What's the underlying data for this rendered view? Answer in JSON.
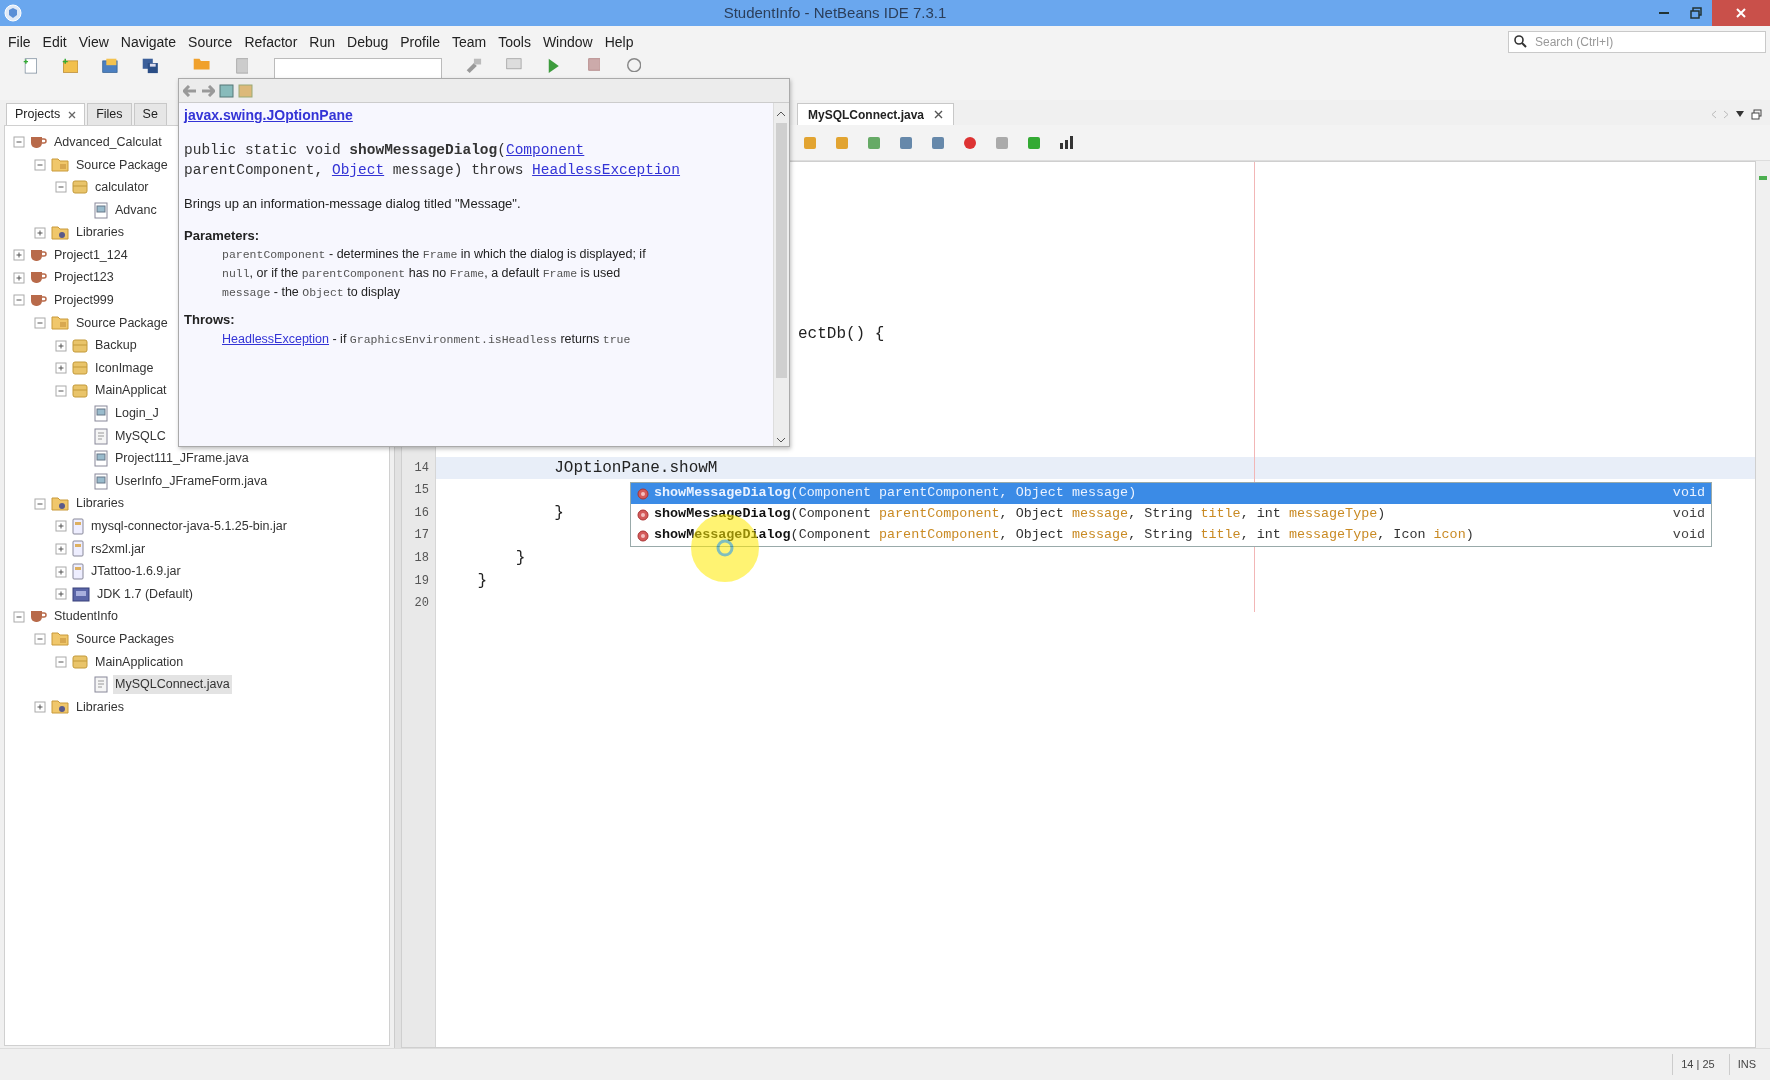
{
  "window": {
    "title": "StudentInfo - NetBeans IDE 7.3.1"
  },
  "menu": [
    "File",
    "Edit",
    "View",
    "Navigate",
    "Source",
    "Refactor",
    "Run",
    "Debug",
    "Profile",
    "Team",
    "Tools",
    "Window",
    "Help"
  ],
  "search": {
    "placeholder": "Search (Ctrl+I)"
  },
  "left_tabs": [
    {
      "label": "Projects",
      "selected": true
    },
    {
      "label": "Files",
      "selected": false
    },
    {
      "label": "Se",
      "selected": false
    }
  ],
  "project_tree": [
    {
      "label": "Advanced_Calculat",
      "kind": "project",
      "expanded": true,
      "selected": false,
      "children": [
        {
          "label": "Source Package",
          "kind": "sources",
          "expanded": true,
          "selected": false,
          "children": [
            {
              "label": "calculator",
              "kind": "package",
              "expanded": true,
              "selected": false,
              "children": [
                {
                  "label": "Advanc",
                  "kind": "form",
                  "selected": false
                }
              ]
            }
          ]
        },
        {
          "label": "Libraries",
          "kind": "libraries",
          "expanded": false,
          "selected": false
        }
      ]
    },
    {
      "label": "Project1_124",
      "kind": "project",
      "expanded": false,
      "selected": false
    },
    {
      "label": "Project123",
      "kind": "project",
      "expanded": false,
      "selected": false
    },
    {
      "label": "Project999",
      "kind": "project",
      "expanded": true,
      "selected": false,
      "children": [
        {
          "label": "Source Package",
          "kind": "sources",
          "expanded": true,
          "selected": false,
          "children": [
            {
              "label": "Backup",
              "kind": "package",
              "expanded": false,
              "selected": false
            },
            {
              "label": "IconImage",
              "kind": "package",
              "expanded": false,
              "selected": false
            },
            {
              "label": "MainApplicat",
              "kind": "package",
              "expanded": true,
              "selected": false,
              "children": [
                {
                  "label": "Login_J",
                  "kind": "form",
                  "selected": false
                },
                {
                  "label": "MySQLC",
                  "kind": "java",
                  "selected": false
                },
                {
                  "label": "Project111_JFrame.java",
                  "kind": "form",
                  "selected": false
                },
                {
                  "label": "UserInfo_JFrameForm.java",
                  "kind": "form",
                  "selected": false
                }
              ]
            }
          ]
        },
        {
          "label": "Libraries",
          "kind": "libraries",
          "expanded": true,
          "selected": false,
          "children": [
            {
              "label": "mysql-connector-java-5.1.25-bin.jar",
              "kind": "jar",
              "expanded": false,
              "selected": false
            },
            {
              "label": "rs2xml.jar",
              "kind": "jar",
              "expanded": false,
              "selected": false
            },
            {
              "label": "JTattoo-1.6.9.jar",
              "kind": "jar",
              "expanded": false,
              "selected": false
            },
            {
              "label": "JDK 1.7 (Default)",
              "kind": "jdk",
              "expanded": false,
              "selected": false
            }
          ]
        }
      ]
    },
    {
      "label": "StudentInfo",
      "kind": "project",
      "expanded": true,
      "selected": false,
      "children": [
        {
          "label": "Source Packages",
          "kind": "sources",
          "expanded": true,
          "selected": false,
          "children": [
            {
              "label": "MainApplication",
              "kind": "package",
              "expanded": true,
              "selected": false,
              "children": [
                {
                  "label": "MySQLConnect.java",
                  "kind": "java",
                  "selected": true
                }
              ]
            }
          ]
        },
        {
          "label": "Libraries",
          "kind": "libraries",
          "expanded": false,
          "selected": false
        }
      ]
    }
  ],
  "editor_tabs": [
    {
      "label": "MySQLConnect.java",
      "selected": true
    }
  ],
  "code": {
    "lines": [
      {
        "text": "ectDb() {",
        "current": false
      },
      {
        "number": "14",
        "text": "            JOptionPane.showM",
        "current": true
      },
      {
        "number": "15",
        "current": false
      },
      {
        "number": "16",
        "text": "            }",
        "current": false
      },
      {
        "number": "17",
        "current": false
      },
      {
        "number": "18",
        "text": "        }",
        "current": false
      },
      {
        "number": "19",
        "text": "    }",
        "current": false
      },
      {
        "number": "20",
        "current": false
      }
    ]
  },
  "completion": {
    "items": [
      {
        "selected": true,
        "return": "void",
        "segments": [
          {
            "text": "showMessageDialog",
            "kind": "name"
          },
          {
            "text": "(Component ",
            "kind": "type"
          },
          {
            "text": "parentComponent",
            "kind": "param"
          },
          {
            "text": ", Object ",
            "kind": "type"
          },
          {
            "text": "message",
            "kind": "param"
          },
          {
            "text": ")",
            "kind": "type"
          }
        ]
      },
      {
        "selected": false,
        "return": "void",
        "segments": [
          {
            "text": "showMessageDialog",
            "kind": "name"
          },
          {
            "text": "(Component ",
            "kind": "type"
          },
          {
            "text": "parentComponent",
            "kind": "param"
          },
          {
            "text": ", Object ",
            "kind": "type"
          },
          {
            "text": "message",
            "kind": "param"
          },
          {
            "text": ", String ",
            "kind": "type"
          },
          {
            "text": "title",
            "kind": "param"
          },
          {
            "text": ", int ",
            "kind": "type"
          },
          {
            "text": "messageType",
            "kind": "param"
          },
          {
            "text": ")",
            "kind": "type"
          }
        ]
      },
      {
        "selected": false,
        "return": "void",
        "segments": [
          {
            "text": "showMessageDialog",
            "kind": "name"
          },
          {
            "text": "(Component ",
            "kind": "type"
          },
          {
            "text": "parentComponent",
            "kind": "param"
          },
          {
            "text": ", Object ",
            "kind": "type"
          },
          {
            "text": "message",
            "kind": "param"
          },
          {
            "text": ", String ",
            "kind": "type"
          },
          {
            "text": "title",
            "kind": "param"
          },
          {
            "text": ", int ",
            "kind": "type"
          },
          {
            "text": "messageType",
            "kind": "param"
          },
          {
            "text": ", Icon ",
            "kind": "type"
          },
          {
            "text": "icon",
            "kind": "param"
          },
          {
            "text": ")",
            "kind": "type"
          }
        ]
      }
    ]
  },
  "javadoc": {
    "class_link": "javax.swing.JOptionPane",
    "signature": [
      [
        {
          "text": "public static void ",
          "kind": "plain"
        },
        {
          "text": "showMessageDialog",
          "kind": "bold"
        },
        {
          "text": "(",
          "kind": "plain"
        },
        {
          "text": "Component",
          "kind": "link"
        }
      ],
      [
        {
          "text": "parentComponent, ",
          "kind": "plain"
        },
        {
          "text": "Object",
          "kind": "link"
        },
        {
          "text": " message) throws ",
          "kind": "plain"
        },
        {
          "text": "HeadlessException",
          "kind": "link"
        }
      ]
    ],
    "description": "Brings up an information-message dialog titled \"Message\".",
    "sections": [
      {
        "heading": "Parameters:",
        "entries": [
          [
            {
              "text": "parentComponent",
              "kind": "code"
            },
            {
              "text": " - determines the ",
              "kind": "plain"
            },
            {
              "text": "Frame",
              "kind": "code"
            },
            {
              "text": " in which the dialog is displayed; if ",
              "kind": "plain"
            },
            {
              "text": "null",
              "kind": "code"
            },
            {
              "text": ", or if the ",
              "kind": "plain"
            },
            {
              "text": "parentComponent",
              "kind": "code"
            },
            {
              "text": " has no ",
              "kind": "plain"
            },
            {
              "text": "Frame",
              "kind": "code"
            },
            {
              "text": ", a default ",
              "kind": "plain"
            },
            {
              "text": "Frame",
              "kind": "code"
            },
            {
              "text": " is used",
              "kind": "plain"
            }
          ],
          [
            {
              "text": "message",
              "kind": "code"
            },
            {
              "text": " - the ",
              "kind": "plain"
            },
            {
              "text": "Object",
              "kind": "code"
            },
            {
              "text": " to display",
              "kind": "plain"
            }
          ]
        ]
      },
      {
        "heading": "Throws:",
        "entries": [
          [
            {
              "text": "HeadlessException",
              "kind": "link"
            },
            {
              "text": " - if ",
              "kind": "plain"
            },
            {
              "text": "GraphicsEnvironment.isHeadless",
              "kind": "code"
            },
            {
              "text": " returns ",
              "kind": "plain"
            },
            {
              "text": "true",
              "kind": "code"
            }
          ]
        ]
      }
    ]
  },
  "pointer": {
    "kind": "highlight"
  },
  "status_bar": {
    "position": "14 | 25",
    "mode": "INS"
  }
}
